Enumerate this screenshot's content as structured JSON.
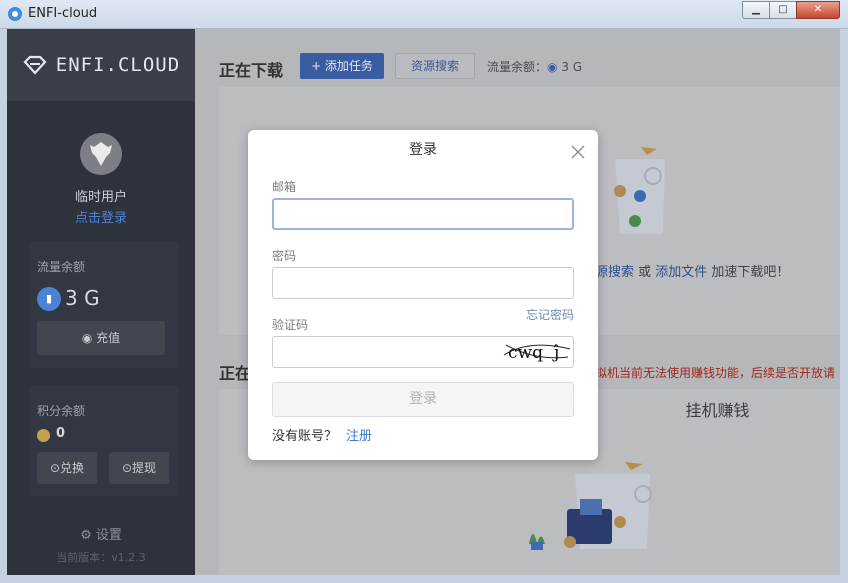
{
  "window": {
    "title": "ENFI-cloud",
    "buttons": {
      "minimize": "▁",
      "maximize": "□",
      "close": "✕"
    }
  },
  "sidebar": {
    "brand": "ENFI.CLOUD",
    "user_name": "临时用户",
    "login_link": "点击登录",
    "traffic": {
      "label": "流量余额",
      "value": "3 G",
      "recharge": "充值"
    },
    "points": {
      "label": "积分余额",
      "value": "0",
      "exchange": "兑换",
      "withdraw": "提现"
    },
    "settings": "设置",
    "version": "当前版本：v1.2.3"
  },
  "main": {
    "downloading_title": "正在下载",
    "add_task": "+ 添加任务",
    "resource_search": "资源搜索",
    "traffic_label": "流量余额：",
    "traffic_value": "3 G",
    "hint_link_search": "源搜索",
    "hint_or": " 或 ",
    "hint_link_add": "添加文件",
    "hint_suffix": " 加速下载吧！",
    "section2_title": "正在",
    "warning": "拟机当前无法使用赚钱功能，后续是否开放请",
    "earn_tab": "挂机赚钱"
  },
  "login_modal": {
    "title": "登录",
    "email_label": "邮箱",
    "email_value": "",
    "password_label": "密码",
    "password_value": "",
    "captcha_label": "验证码",
    "captcha_value": "",
    "captcha_text": "cwq",
    "forgot": "忘记密码",
    "submit": "登录",
    "no_account": "没有账号？",
    "register": "注册"
  },
  "colors": {
    "accent": "#3a7bd5",
    "sidebar_bg": "#2e323d",
    "warning": "#a0281c"
  }
}
